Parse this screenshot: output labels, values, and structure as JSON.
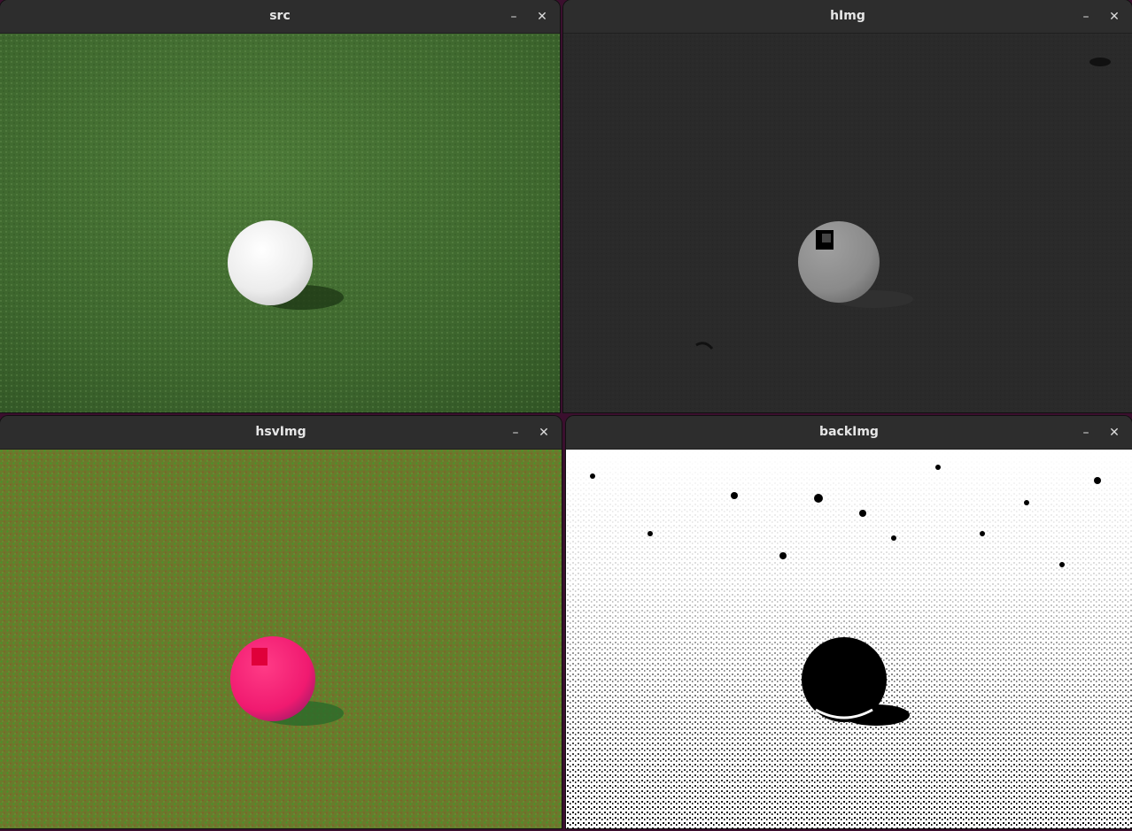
{
  "windows": [
    {
      "id": "src",
      "title": "src",
      "minimize": "–",
      "close": "✕"
    },
    {
      "id": "hImg",
      "title": "hImg",
      "minimize": "–",
      "close": "✕"
    },
    {
      "id": "hsvImg",
      "title": "hsvImg",
      "minimize": "–",
      "close": "✕"
    },
    {
      "id": "backImg",
      "title": "backImg",
      "minimize": "–",
      "close": "✕"
    }
  ],
  "icons": {
    "minimize": "minimize-icon",
    "close": "close-icon"
  },
  "colors": {
    "desktop": "#3b0f2e",
    "titlebar": "#2d2d2d",
    "grass": "#3f6a2e",
    "ball": "#f2f2f2",
    "himg_bg": "#2a2a2a",
    "hsv_ball": "#ff2277",
    "hsv_grass": "#6f7a2a",
    "back_fg": "#ffffff",
    "back_bg": "#000000"
  }
}
